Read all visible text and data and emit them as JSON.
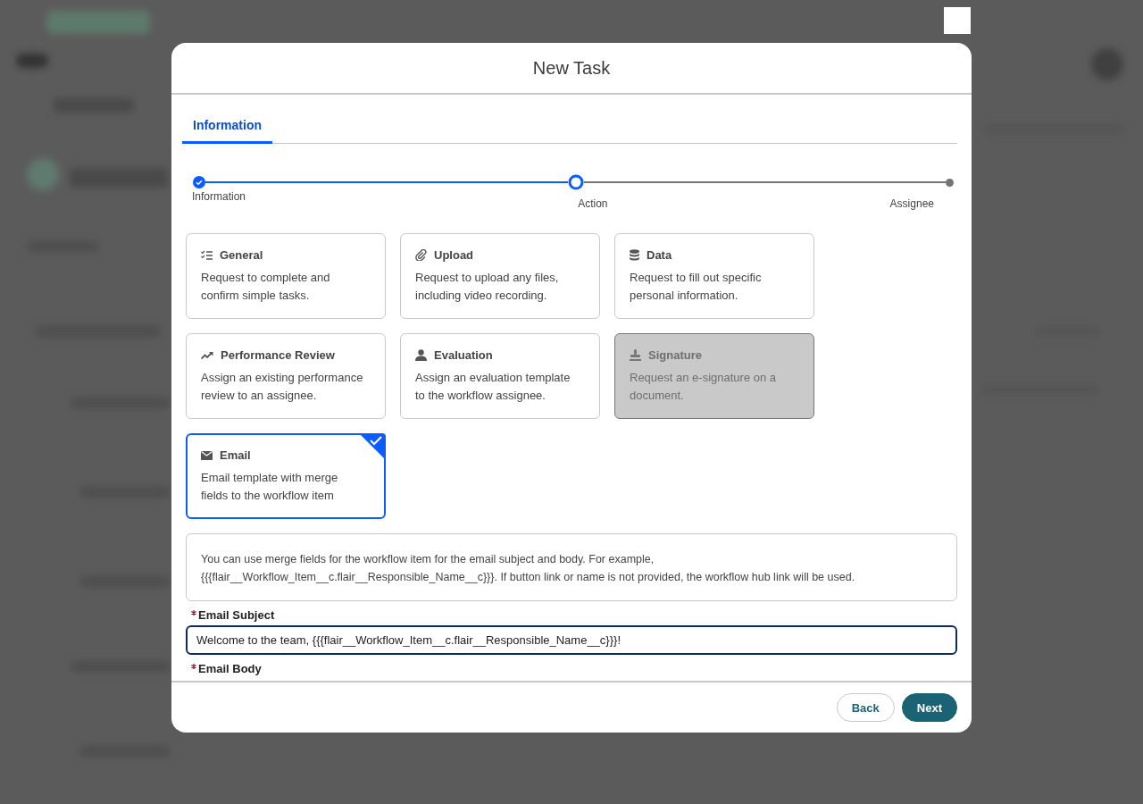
{
  "modal": {
    "title": "New Task"
  },
  "tabs": [
    {
      "label": "Information",
      "selected": true
    }
  ],
  "steps": [
    {
      "label": "Information",
      "done": true,
      "current": false
    },
    {
      "label": "Action",
      "done": false,
      "current": true
    },
    {
      "label": "Assignee",
      "done": false,
      "current": false
    }
  ],
  "task_types": [
    {
      "kind": "general",
      "title": "General",
      "description": "Request to complete and confirm simple tasks.",
      "selected": false,
      "disabled": false
    },
    {
      "kind": "upload",
      "title": "Upload",
      "description": "Request to upload any files, including video recording.",
      "selected": false,
      "disabled": false
    },
    {
      "kind": "data",
      "title": "Data",
      "description": "Request to fill out specific personal information.",
      "selected": false,
      "disabled": false
    },
    {
      "kind": "performance",
      "title": "Performance Review",
      "description": "Assign an existing performance review to an assignee.",
      "selected": false,
      "disabled": false
    },
    {
      "kind": "evaluation",
      "title": "Evaluation",
      "description": "Assign an evaluation template to the workflow assignee.",
      "selected": false,
      "disabled": false
    },
    {
      "kind": "signature",
      "title": "Signature",
      "description": "Request an e-signature on a document.",
      "selected": false,
      "disabled": true
    },
    {
      "kind": "email",
      "title": "Email",
      "description": "Email template with merge fields to the workflow item",
      "selected": true,
      "disabled": false
    }
  ],
  "info_text": "You can use merge fields for the workflow item for the email subject and body. For example, {{{flair__Workflow_Item__c.flair__Responsible_Name__c}}}. If button link or name is not provided, the workflow hub link will be used.",
  "fields": [
    {
      "kind": "input",
      "label": "Email Subject",
      "required": true,
      "value": "Welcome to the team, {{{flair__Workflow_Item__c.flair__Responsible_Name__c}}}!"
    },
    {
      "kind": "label",
      "label": "Email Body",
      "required": true
    }
  ],
  "buttons": [
    {
      "label": "Back",
      "kind": "secondary"
    },
    {
      "label": "Next",
      "kind": "primary"
    }
  ]
}
